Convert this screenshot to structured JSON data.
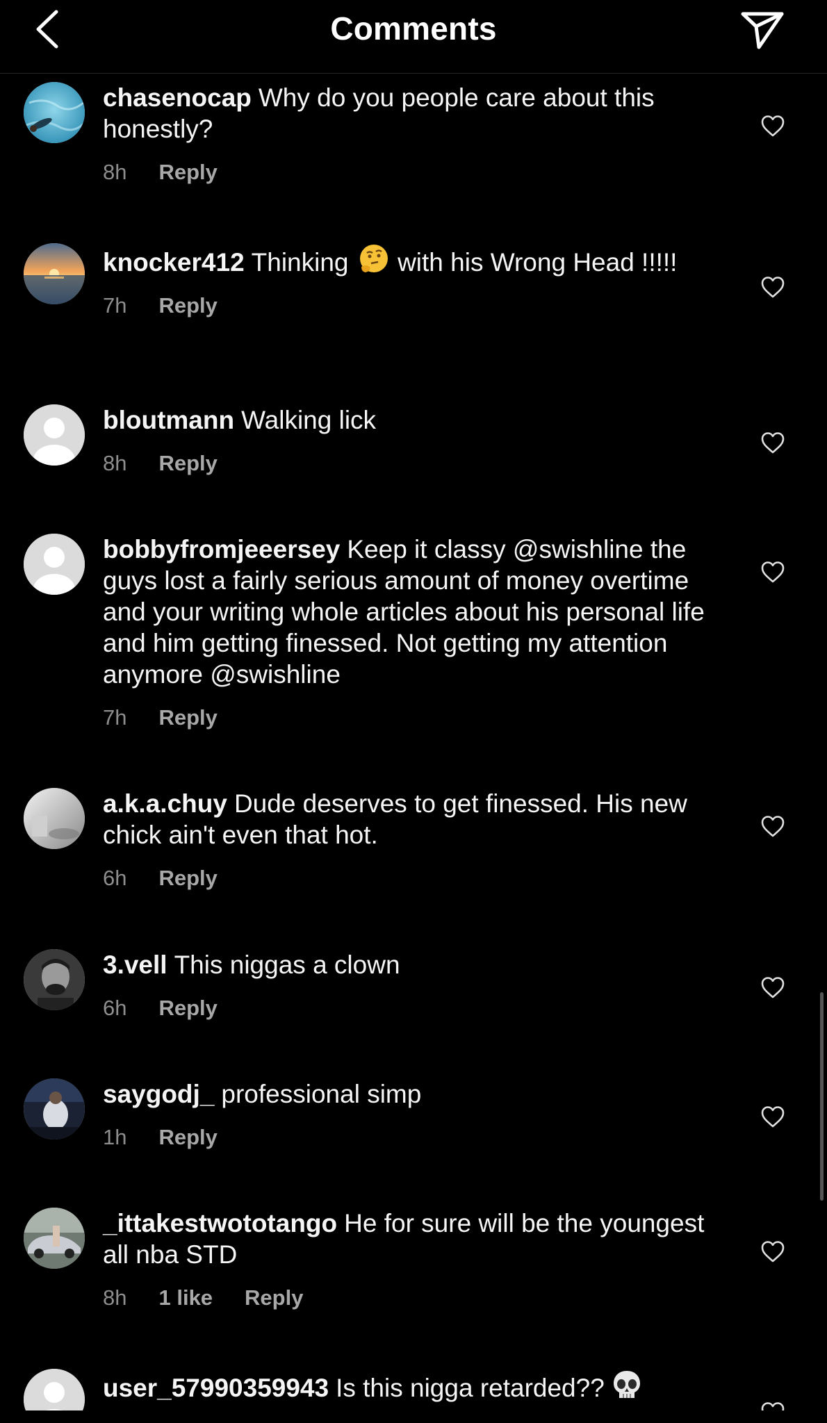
{
  "header": {
    "title": "Comments",
    "back_icon": "chevron-left-icon",
    "send_icon": "paper-plane-icon"
  },
  "comments": [
    {
      "username": "chasenocap",
      "text": "Why do you people care about this honestly?",
      "time": "8h",
      "reply": "Reply",
      "avatar": "water-photo"
    },
    {
      "username": "knocker412",
      "text_before": "Thinking",
      "emoji": "thinking-face-emoji",
      "text_after": "with his Wrong Head !!!!!",
      "time": "7h",
      "reply": "Reply",
      "avatar": "sunset-photo"
    },
    {
      "username": "bloutmann",
      "text": "Walking lick",
      "time": "8h",
      "reply": "Reply",
      "avatar": "default-avatar"
    },
    {
      "username": "bobbyfromjeeersey",
      "text": "Keep it classy @swishline the guys lost a fairly serious amount of money overtime and your writing whole articles about his personal life and him getting finessed. Not getting my attention anymore @swishline",
      "time": "7h",
      "reply": "Reply",
      "avatar": "default-avatar"
    },
    {
      "username": "a.k.a.chuy",
      "text": "Dude deserves to get finessed.  His new chick ain't even that hot.",
      "time": "6h",
      "reply": "Reply",
      "avatar": "grey-photo"
    },
    {
      "username": "3.vell",
      "text": "This niggas a clown",
      "time": "6h",
      "reply": "Reply",
      "avatar": "portrait-photo"
    },
    {
      "username": "saygodj_",
      "text": "professional simp",
      "time": "1h",
      "reply": "Reply",
      "avatar": "car-interior-photo"
    },
    {
      "username": "_ittakestwototango",
      "text": "He for sure will be the youngest all nba STD",
      "time": "8h",
      "likes": "1 like",
      "reply": "Reply",
      "avatar": "car-photo"
    },
    {
      "username": "user_57990359943",
      "text": "Is this nigga retarded??",
      "emoji": "skull-emoji",
      "avatar": "default-avatar"
    }
  ],
  "colors": {
    "background": "#000000",
    "text": "#f5f5f5",
    "meta": "#8e8e8e",
    "divider": "#262626"
  }
}
